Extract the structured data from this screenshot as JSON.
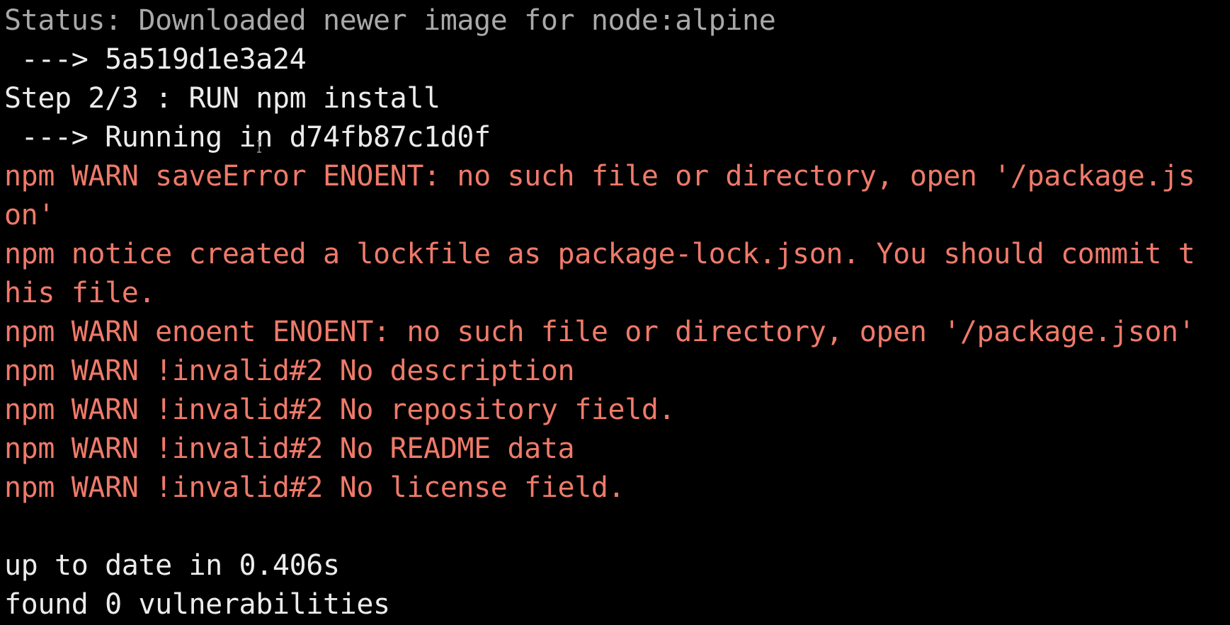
{
  "terminal": {
    "lines": [
      {
        "text": "Status: Downloaded newer image for node:alpine",
        "color": "#a9a9a9"
      },
      {
        "text": " ---> 5a519d1e3a24",
        "color": "#ececec"
      },
      {
        "text": "Step 2/3 : RUN npm install",
        "color": "#ececec"
      },
      {
        "text": " ---> Running in d74fb87c1d0f",
        "color": "#ececec"
      },
      {
        "text": "npm WARN saveError ENOENT: no such file or directory, open '/package.js",
        "color": "#ef7a6a"
      },
      {
        "text": "on'",
        "color": "#ef7a6a"
      },
      {
        "text": "npm notice created a lockfile as package-lock.json. You should commit t",
        "color": "#ef7a6a"
      },
      {
        "text": "his file.",
        "color": "#ef7a6a"
      },
      {
        "text": "npm WARN enoent ENOENT: no such file or directory, open '/package.json'",
        "color": "#ef7a6a"
      },
      {
        "text": "npm WARN !invalid#2 No description",
        "color": "#ef7a6a"
      },
      {
        "text": "npm WARN !invalid#2 No repository field.",
        "color": "#ef7a6a"
      },
      {
        "text": "npm WARN !invalid#2 No README data",
        "color": "#ef7a6a"
      },
      {
        "text": "npm WARN !invalid#2 No license field.",
        "color": "#ef7a6a"
      },
      {
        "text": "",
        "color": "#ececec"
      },
      {
        "text": "up to date in 0.406s",
        "color": "#ececec"
      },
      {
        "text": "found 0 vulnerabilities",
        "color": "#ececec"
      }
    ],
    "mouse_cursor": "text-cursor-icon",
    "background": "#000000"
  }
}
